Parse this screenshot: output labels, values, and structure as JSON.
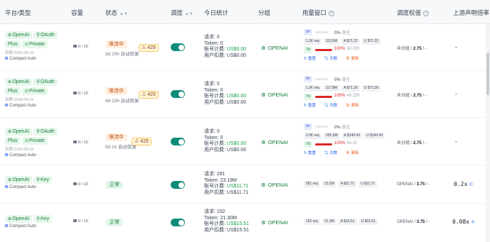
{
  "headers": {
    "platform": "平台/类型",
    "capacity": "容量",
    "status": "状态",
    "schedule": "调度",
    "today": "今日统计",
    "group": "分组",
    "usage": "用量窗口",
    "weight": "调度权值",
    "upstream": "上游声明倍率"
  },
  "colors": {
    "accent": "#0f8b7a",
    "green": "#16a34a",
    "orange": "#c2410c",
    "red": "#dc2626"
  },
  "rows": [
    {
      "tags1": [
        "OpenAI",
        "OAuth"
      ],
      "tags2": [
        "Plus",
        "Private"
      ],
      "expire": "到期 2026-08-30",
      "sched": "Compact Auto",
      "capacity": "0 / 10",
      "status": "限流中",
      "status_sub": "3d 20h 自动恢复",
      "warn": "429",
      "stats": {
        "req": "请求: 0",
        "token": "Token: 0",
        "acct_label": "账号计费: ",
        "acct_val": "US$0.00",
        "user_label": "用户扣费: ",
        "user_val": "US$0.00"
      },
      "group": "OPENAI",
      "usage": {
        "win5h": "5h",
        "pct5h": "0%",
        "pct5h_num": 0,
        "note5h": "现在",
        "chips": [
          "1.2K req",
          "113.6M",
          "A $71.22",
          "U $71.22"
        ],
        "win7d": "7d",
        "pct7d": "100%",
        "pct7d_num": 100,
        "note7d": "3d 20h",
        "link_reset": "重置",
        "link_count": "次数",
        "link_clear": "清除"
      },
      "weight_label": "未分组",
      "weight_val": "2.75",
      "upstream": "-",
      "upstream_link": ""
    },
    {
      "tags1": [
        "OpenAI",
        "OAuth"
      ],
      "tags2": [
        "Plus",
        "Private"
      ],
      "expire": "到期 2026-09-02",
      "sched": "Compact Auto",
      "capacity": "0 / 10",
      "status": "限流中",
      "status_sub": "4d 23h 自动恢复",
      "warn": "429",
      "stats": {
        "req": "请求: 0",
        "token": "Token: 0",
        "acct_label": "账号计费: ",
        "acct_val": "US$0.00",
        "user_label": "用户扣费: ",
        "user_val": "US$0.00"
      },
      "group": "OPENAI",
      "usage": {
        "win5h": "5h",
        "pct5h": "0%",
        "pct5h_num": 0,
        "note5h": "现在",
        "chips": [
          "1.2K req",
          "117.8M",
          "A $71.26",
          "U $71.26"
        ],
        "win7d": "7d",
        "pct7d": "100%",
        "pct7d_num": 100,
        "note7d": "4d 23h",
        "link_reset": "重置",
        "link_count": "次数",
        "link_clear": "清除"
      },
      "weight_label": "未分组",
      "weight_val": "2.75",
      "upstream": "-",
      "upstream_link": ""
    },
    {
      "tags1": [
        "OpenAI",
        "OAuth"
      ],
      "tags2": [
        "Plus",
        "Private"
      ],
      "expire": "到期 2026-09-02",
      "sched": "Compact Auto",
      "capacity": "0 / 10",
      "status": "限流中",
      "status_sub": "5d 1h 自动恢复",
      "warn": "429",
      "stats": {
        "req": "请求: 0",
        "token": "Token: 0",
        "acct_label": "账号计费: ",
        "acct_val": "US$0.00",
        "user_label": "用户扣费: ",
        "user_val": "US$0.00"
      },
      "group": "OPENAI",
      "usage": {
        "win5h": "5h",
        "pct5h": "0%",
        "pct5h_num": 0,
        "note5h": "现在",
        "chips": [
          "2.0K req",
          "235.3M",
          "A $140.43",
          "U $140.43"
        ],
        "win7d": "7d",
        "pct7d": "100%",
        "pct7d_num": 100,
        "note7d": "5d 1h",
        "link_reset": "重置",
        "link_count": "次数",
        "link_clear": "清除"
      },
      "weight_label": "未分组",
      "weight_val": "2.75",
      "upstream": "-",
      "upstream_link": ""
    },
    {
      "tags1": [
        "OpenAI",
        "Key"
      ],
      "tags2": [],
      "expire": "",
      "sched": "Compact Auto",
      "capacity": "0 / 10",
      "status": "正常",
      "status_sub": "",
      "warn": "",
      "stats": {
        "req": "请求: 281",
        "token": "Token: 23.19M",
        "acct_label": "账号计费: ",
        "acct_val": "US$11.71",
        "user_label": "用户扣费: ",
        "user_val": "US$11.71"
      },
      "group": "OPENAI",
      "usage": {
        "chips": [
          "281 req",
          "23.2M",
          "A $11.71",
          "U $11.71"
        ]
      },
      "weight_label": "OPENAI",
      "weight_val": "3.75",
      "upstream": "0.2x",
      "upstream_link": "©"
    },
    {
      "tags1": [
        "OpenAI",
        "Key"
      ],
      "tags2": [],
      "expire": "",
      "sched": "Compact Auto",
      "capacity": "0 / 10",
      "status": "正常",
      "status_sub": "",
      "warn": "",
      "stats": {
        "req": "请求: 152",
        "token": "Token: 21.30M",
        "acct_label": "账号计费: ",
        "acct_val": "US$15.51",
        "user_label": "用户扣费: ",
        "user_val": "US$15.51"
      },
      "group": "OPENAI",
      "usage": {
        "chips": [
          "152 req",
          "21.3M",
          "A $15.51",
          "U $15.51"
        ]
      },
      "weight_label": "OPENAI",
      "weight_val": "3.75",
      "upstream": "0.08x",
      "upstream_link": "©"
    }
  ]
}
